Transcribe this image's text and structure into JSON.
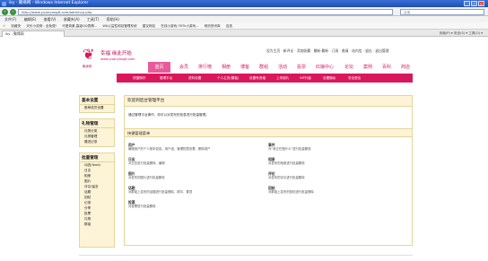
{
  "window": {
    "title": "iky - 聚缘网 - Windows Internet Explorer"
  },
  "addressbar": {
    "url": "http://www.yuanyang8.com/admincp.php",
    "search_placeholder": "百度"
  },
  "menubar": {
    "items": [
      "文件(F)",
      "编辑(E)",
      "查看(V)",
      "收藏夹(A)",
      "工具(T)",
      "帮助(H)"
    ]
  },
  "favorites": {
    "label": "收藏夹",
    "items": [
      "天价小说网 - 全免费!",
      "可爱背景,高级QQ表情...",
      "WA公益性网站管理系统",
      "建议网站",
      "在线小游戏,767k小游戏...",
      "网页快讯库",
      "自选"
    ]
  },
  "tab": {
    "title": "iky - 聚缘网",
    "tools": "页面(P) ▾  安全(S) ▾  工具(O) ▾"
  },
  "site": {
    "logo_name": "幸福 缘此开始",
    "logo_domain": "www.yuanyang8.com",
    "logo_sub": "聚缘网",
    "toplinks": "设为主页 · 新评论 · 添加收藏 · 最新·最新 · 订阅 · 邀请 · 站内信 · 退出 · 退出管理"
  },
  "nav": {
    "active": "首页",
    "items": [
      "会员",
      "排行榜",
      "相册",
      "博客",
      "群组",
      "活动",
      "投票",
      "红娘中心",
      "论坛",
      "案例",
      "百科",
      "商店"
    ]
  },
  "subnav": {
    "items": [
      "快捷操作",
      "管理平台",
      "资料设置",
      "个人主页(模板)",
      "设置有资格",
      "上传相片",
      "VIP升级",
      "设置隐私",
      "安全退出"
    ]
  },
  "sidebar": {
    "groups": [
      {
        "title": "基本设置",
        "links": [
          "推荐成员设置"
        ]
      },
      {
        "title": "礼物管理",
        "links": [
          "礼物分类",
          "礼物管理",
          "赠送记录"
        ]
      },
      {
        "title": "批量管理",
        "links": [
          "动态(feed)",
          "日志",
          "相册",
          "图片",
          "评论/留言",
          "话题",
          "回帖",
          "记录",
          "分享",
          "投票",
          "礼物",
          "群组"
        ]
      }
    ]
  },
  "main": {
    "header": "欢迎到后台管理平台",
    "intro": "通过管理平台操作，你可以对发布的信息进行批量管理。",
    "quick_header": "快捷管理菜单",
    "quick": [
      {
        "title": "用户",
        "desc": "编辑用户的个人基本信息、用户组、管理权限设置、删除用户"
      },
      {
        "title": "事件",
        "desc": "对“我正在做什么”进行批量删除"
      },
      {
        "title": "日志",
        "desc": "对日志进行批量删除、编辑"
      },
      {
        "title": "相册",
        "desc": "对发布的相册进行批量删除"
      },
      {
        "title": "图片",
        "desc": "对发布的图片进行批量删除"
      },
      {
        "title": "评论",
        "desc": "对发布的评论进行批量删除"
      },
      {
        "title": "话题",
        "desc": "对群组上发布的话题进行批量删除、精华、置顶"
      },
      {
        "title": "回帖",
        "desc": "对群组上发布的回帖进行批量删除"
      },
      {
        "title": "投票",
        "desc": "对投票进行批量删除"
      }
    ]
  }
}
